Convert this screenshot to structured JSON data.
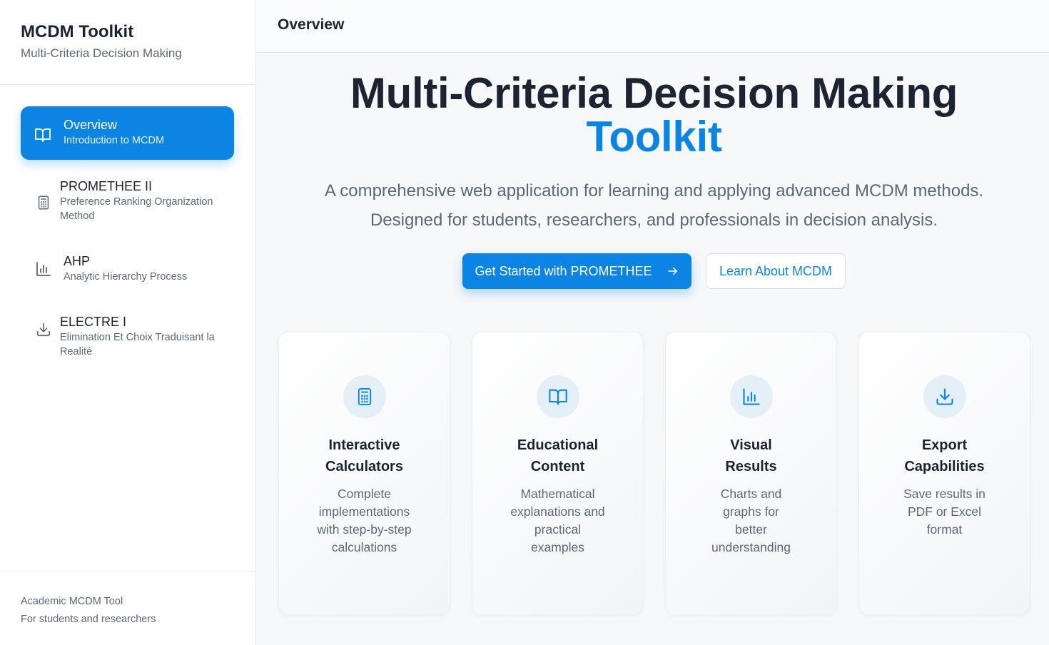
{
  "app": {
    "title": "MCDM Toolkit",
    "subtitle": "Multi-Criteria Decision Making"
  },
  "sidebar": {
    "items": [
      {
        "label": "Overview",
        "desc": "Introduction to MCDM",
        "icon": "book-open-icon",
        "active": true
      },
      {
        "label": "PROMETHEE II",
        "desc": "Preference Ranking Organization Method",
        "icon": "calculator-icon",
        "active": false
      },
      {
        "label": "AHP",
        "desc": "Analytic Hierarchy Process",
        "icon": "bar-chart-icon",
        "active": false
      },
      {
        "label": "ELECTRE I",
        "desc": "Elimination Et Choix Traduisant la Realité",
        "icon": "download-icon",
        "active": false
      }
    ],
    "footer": {
      "line1": "Academic MCDM Tool",
      "line2": "For students and researchers"
    }
  },
  "header": {
    "title": "Overview"
  },
  "hero": {
    "title": "Multi-Criteria Decision Making",
    "accent": "Toolkit",
    "description": "A comprehensive web application for learning and applying advanced MCDM methods. Designed for students, researchers, and professionals in decision analysis.",
    "primary_button": "Get Started with PROMETHEE",
    "secondary_button": "Learn About MCDM"
  },
  "features": [
    {
      "title": "Interactive Calculators",
      "desc": "Complete implementations with step-by-step calculations",
      "icon": "calculator-icon"
    },
    {
      "title": "Educational Content",
      "desc": "Mathematical explanations and practical examples",
      "icon": "book-open-icon"
    },
    {
      "title": "Visual Results",
      "desc": "Charts and graphs for better understanding",
      "icon": "bar-chart-icon"
    },
    {
      "title": "Export Capabilities",
      "desc": "Save results in PDF or Excel format",
      "icon": "download-icon"
    }
  ],
  "colors": {
    "accent": "#0b84e3",
    "text": "#1b2430",
    "muted": "#5b6877",
    "icon_bg": "#e4eff8"
  }
}
